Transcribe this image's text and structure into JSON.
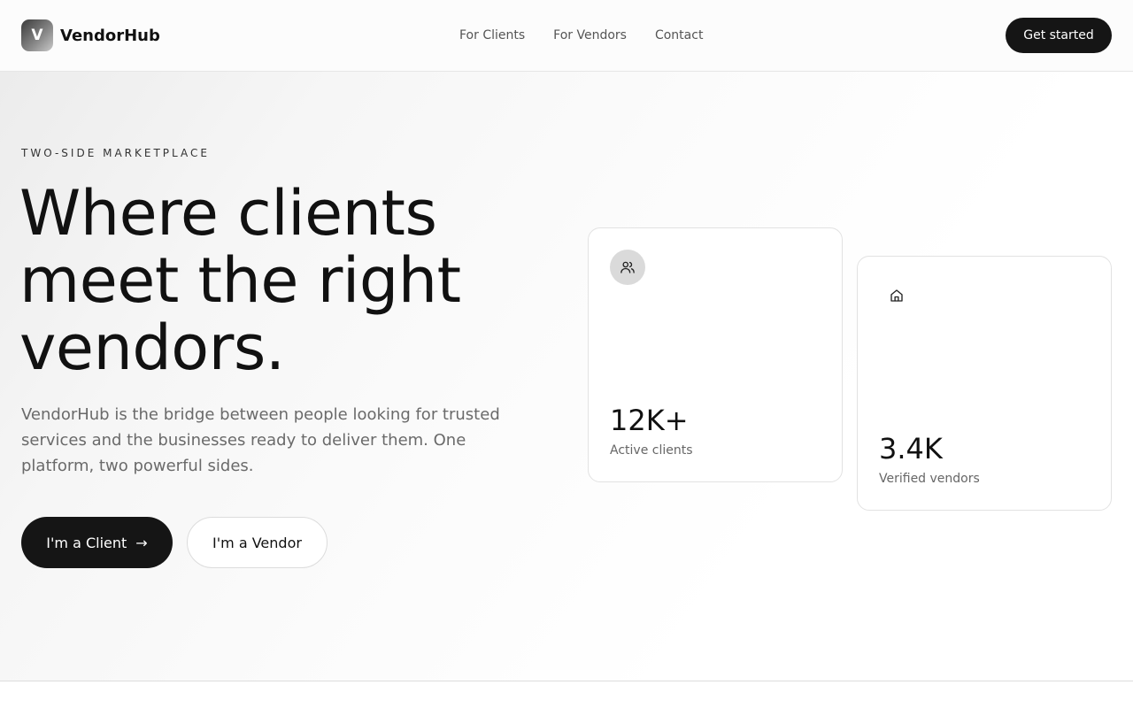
{
  "header": {
    "logo_letter": "V",
    "brand": "VendorHub",
    "nav": [
      "For Clients",
      "For Vendors",
      "Contact"
    ],
    "cta": "Get started"
  },
  "hero": {
    "eyebrow": "TWO-SIDE MARKETPLACE",
    "headline_lines": [
      "Where clients",
      "meet the right",
      "vendors."
    ],
    "subtitle": "VendorHub is the bridge between people looking for trusted services and the businesses ready to deliver them. One platform, two powerful sides.",
    "primary_button": "I'm a Client",
    "primary_button_arrow": "→",
    "secondary_button": "I'm a Vendor"
  },
  "stats": [
    {
      "icon": "users-icon",
      "value": "12K+",
      "label": "Active clients"
    },
    {
      "icon": "store-icon",
      "value": "3.4K",
      "label": "Verified vendors"
    }
  ],
  "colors": {
    "primary": "#151515",
    "muted_text": "#6a6a6a",
    "border": "#e2e2e2"
  }
}
